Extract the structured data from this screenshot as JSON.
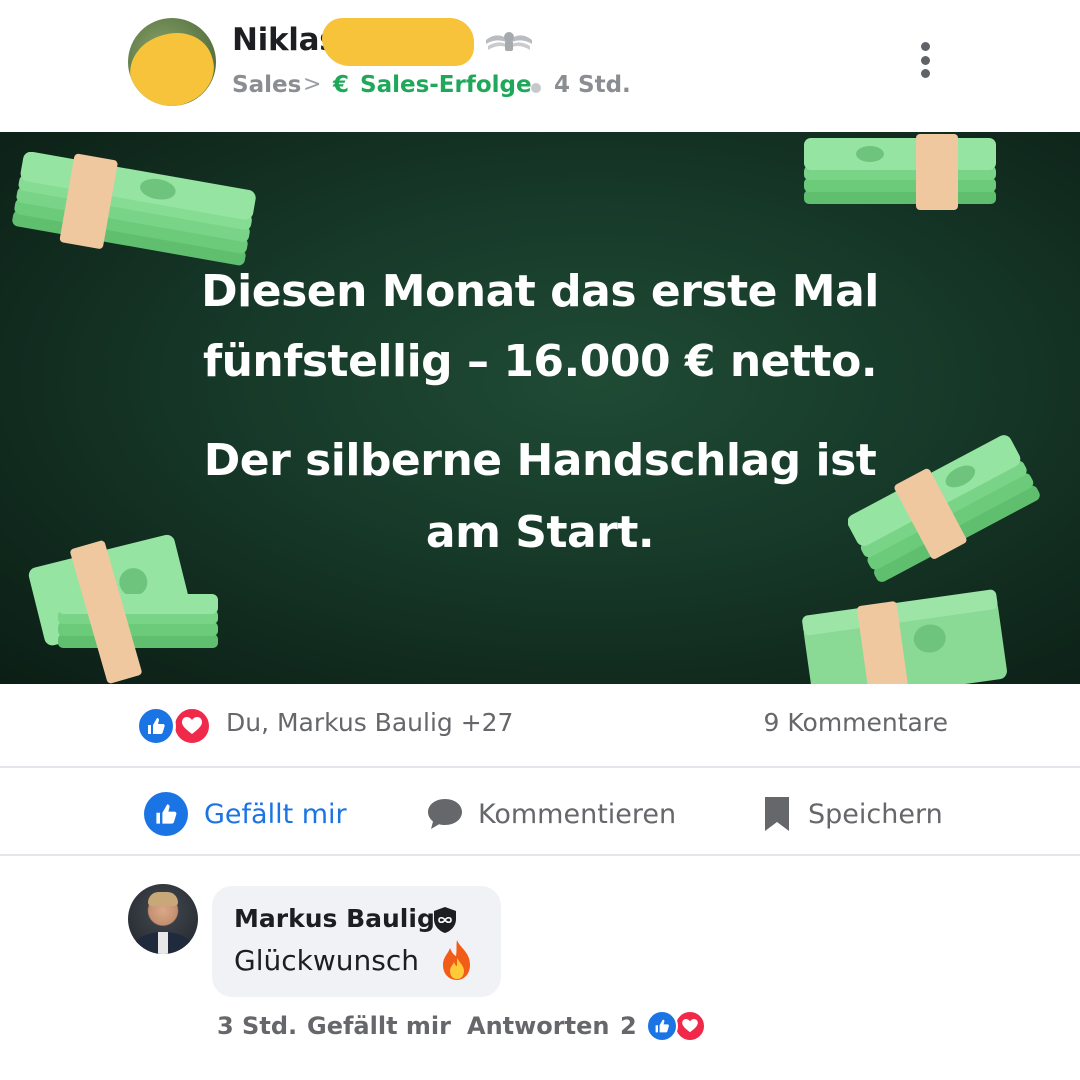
{
  "post": {
    "author_name": "Niklas",
    "breadcrumb": {
      "category": "Sales",
      "separator": ">",
      "group_icon": "€",
      "group": "Sales-Erfolge",
      "time": "4 Std."
    },
    "icons": {
      "badge": "wings-badge-icon",
      "menu": "more-vertical-icon"
    }
  },
  "banner": {
    "line1": "Diesen Monat das erste Mal",
    "line2": "fünfstellig – 16.000 € netto.",
    "line3": "Der silberne Handschlag ist",
    "line4": "am Start.",
    "colors": {
      "background": "#163828",
      "text": "#ffffff",
      "money": "#7fd88a",
      "band": "#f1c9a0"
    }
  },
  "reactions": {
    "reactors": "Du, Markus Baulig +27",
    "comments": "9 Kommentare"
  },
  "actions": {
    "like": "Gefällt mir",
    "comment": "Kommentieren",
    "save": "Speichern"
  },
  "comment": {
    "author": "Markus Baulig",
    "text": "Glückwunsch",
    "time": "3 Std.",
    "like": "Gefällt mir",
    "reply": "Antworten",
    "reaction_count": "2"
  },
  "colors": {
    "accent": "#1b74e4",
    "love": "#f02849",
    "group_green": "#1fa85a",
    "muted": "#65676b"
  }
}
